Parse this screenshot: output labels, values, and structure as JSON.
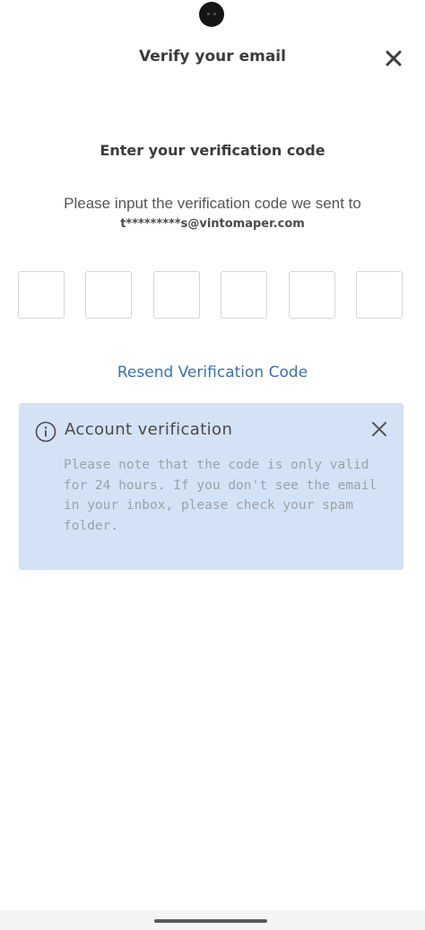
{
  "header": {
    "title": "Verify your email",
    "close_icon": "close-icon"
  },
  "main": {
    "heading": "Enter your verification code",
    "instruction": "Please input the verification code we sent to",
    "masked_email": "t*********s@vintomaper.com",
    "code_digits": [
      "",
      "",
      "",
      "",
      "",
      ""
    ],
    "resend_label": "Resend Verification Code"
  },
  "notice": {
    "icon": "info-icon",
    "title": "Account verification",
    "body": "Please note that the code is only valid for 24 hours. If you don't see the email in your inbox, please check your spam folder.",
    "close_icon": "close-icon"
  },
  "colors": {
    "link": "#3a6fb8",
    "notice_background": "#d3e2f4",
    "notice_text": "#9aa3ad"
  }
}
